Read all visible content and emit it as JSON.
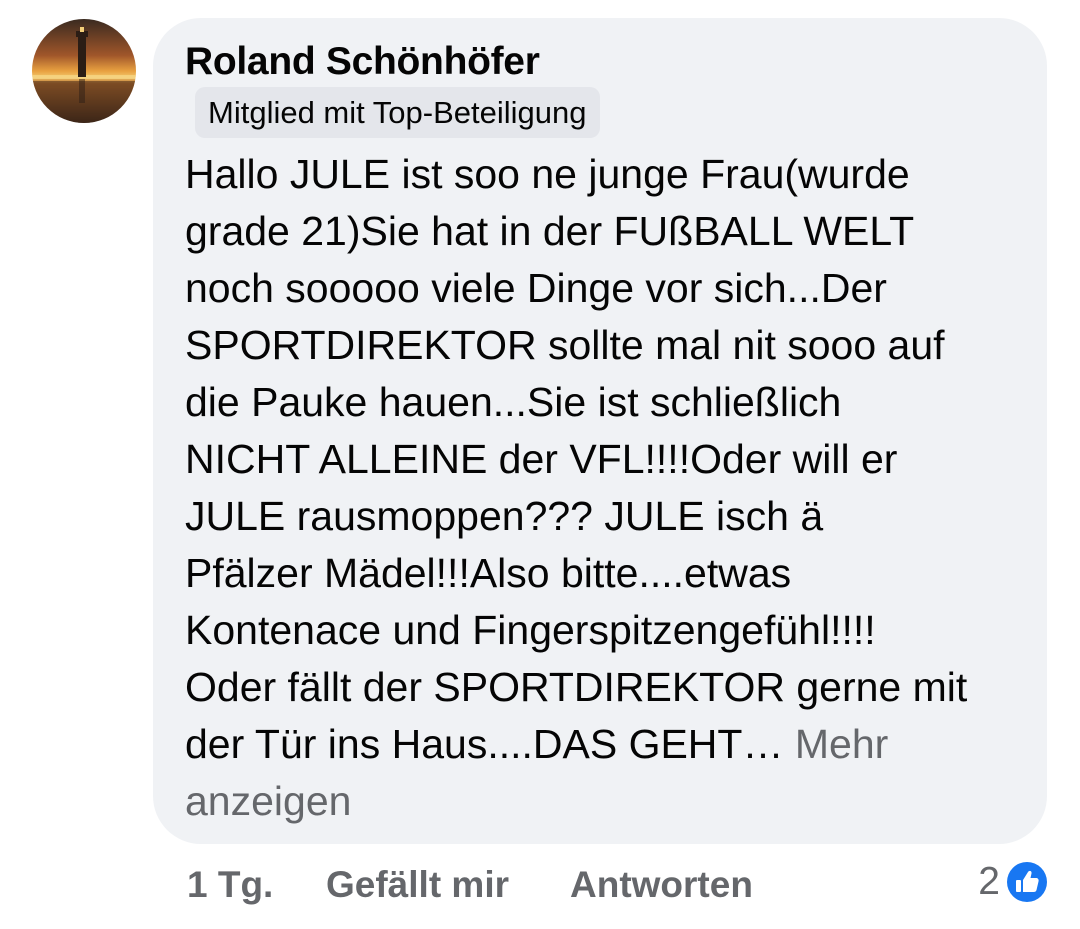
{
  "comment": {
    "author": "Roland Schönhöfer",
    "badge": "Mitglied mit Top-Beteiligung",
    "text_lines": [
      "Hallo JULE ist soo ne junge Frau(wurde",
      "grade 21)Sie hat in der FUßBALL WELT",
      "noch sooooo viele Dinge vor sich...Der",
      "SPORTDIREKTOR sollte mal nit sooo auf",
      "die Pauke hauen...Sie ist schließlich",
      "NICHT ALLEINE der VFL!!!!Oder will er",
      "JULE rausmoppen??? JULE isch ä",
      "Pfälzer Mädel!!!Also bitte....etwas",
      "Kontenace und Fingerspitzengefühl!!!!",
      "Oder fällt der SPORTDIREKTOR gerne mit",
      "der Tür ins Haus....DAS GEHT…"
    ],
    "see_more": "Mehr anzeigen",
    "see_more_parts": [
      "Mehr",
      "anzeigen"
    ]
  },
  "actions": {
    "time": "1 Tg.",
    "like_label": "Gefällt mir",
    "reply_label": "Antworten"
  },
  "reactions": {
    "count": "2",
    "icon": "like-thumbs-up-icon"
  },
  "colors": {
    "bubble_bg": "#f0f2f5",
    "badge_bg": "#e4e6eb",
    "text": "#050505",
    "secondary_text": "#65676b",
    "like_blue": "#1877f2"
  }
}
